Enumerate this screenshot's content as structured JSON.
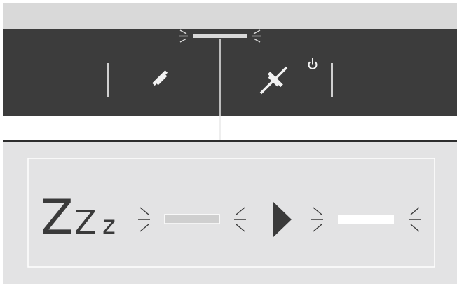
{
  "sleep_symbol": {
    "big": "Z",
    "medium": "Z",
    "small": "z"
  },
  "indicators": {
    "top_led": {
      "state": "blinking",
      "color": "#d8d8d8"
    },
    "dim_led": {
      "state": "blinking",
      "color": "#cfcfcf"
    },
    "bright_led": {
      "state": "blinking",
      "color": "#ffffff"
    }
  },
  "icons": {
    "answer_call": "phone-handset-icon",
    "end_call": "phone-hangup-icon",
    "power": "power-icon",
    "arrow": "play-arrow-icon"
  },
  "colors": {
    "panel_dark": "#3c3c3c",
    "panel_light": "#e3e3e4",
    "top_strip": "#d9d9d9",
    "glyph": "#3a3a3a"
  }
}
